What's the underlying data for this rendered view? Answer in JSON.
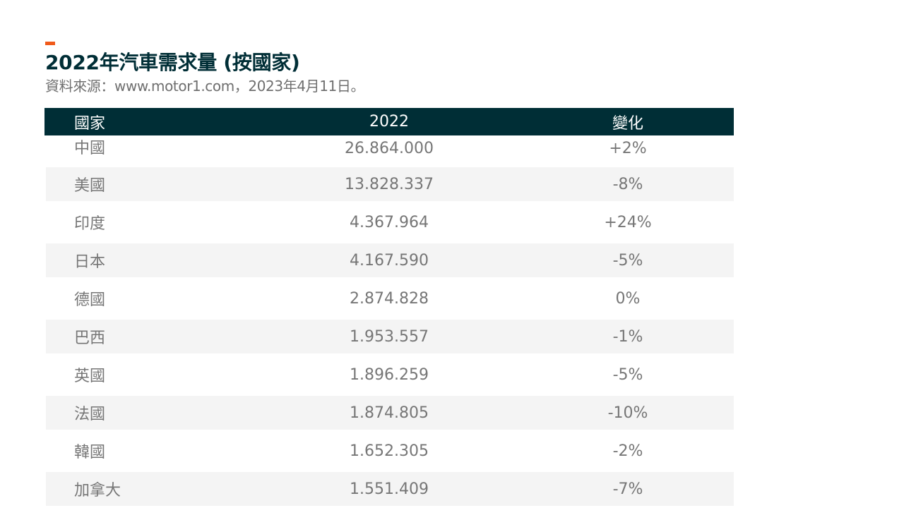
{
  "title": "2022年汽車需求量 (按國家)",
  "subtitle": "資料來源：www.motor1.com，2023年4月11日。",
  "colors": {
    "accent": "#f05a1a",
    "header_bg": "#002e36",
    "title": "#002e36",
    "row_alt": "#f4f4f4",
    "text": "#767676"
  },
  "table": {
    "headers": {
      "country": "國家",
      "year": "2022",
      "change": "變化"
    },
    "rows": [
      {
        "country": "中國",
        "value": "26.864.000",
        "change": "+2%"
      },
      {
        "country": "美國",
        "value": "13.828.337",
        "change": "-8%"
      },
      {
        "country": "印度",
        "value": "4.367.964",
        "change": "+24%"
      },
      {
        "country": "日本",
        "value": "4.167.590",
        "change": "-5%"
      },
      {
        "country": "德國",
        "value": "2.874.828",
        "change": "0%"
      },
      {
        "country": "巴西",
        "value": "1.953.557",
        "change": "-1%"
      },
      {
        "country": "英國",
        "value": "1.896.259",
        "change": "-5%"
      },
      {
        "country": "法國",
        "value": "1.874.805",
        "change": "-10%"
      },
      {
        "country": "韓國",
        "value": "1.652.305",
        "change": "-2%"
      },
      {
        "country": "加拿大",
        "value": "1.551.409",
        "change": "-7%"
      }
    ]
  }
}
